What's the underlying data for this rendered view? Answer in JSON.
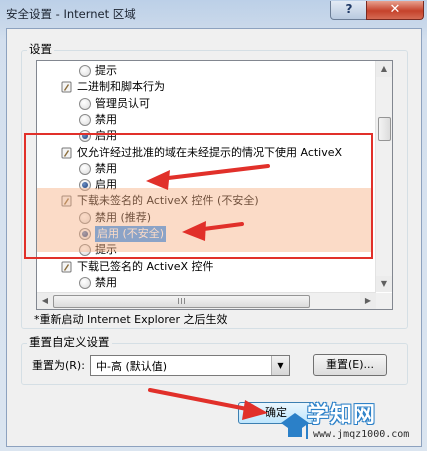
{
  "window": {
    "title": "安全设置 - Internet 区域",
    "help_glyph": "?",
    "close_glyph": "✕"
  },
  "settings_group": {
    "label": "设置",
    "rows": [
      {
        "kind": "radio",
        "text": "提示",
        "checked": false
      },
      {
        "kind": "category",
        "text": "二进制和脚本行为"
      },
      {
        "kind": "radio",
        "text": "管理员认可",
        "checked": false
      },
      {
        "kind": "radio",
        "text": "禁用",
        "checked": false
      },
      {
        "kind": "radio",
        "text": "启用",
        "checked": true
      },
      {
        "kind": "category",
        "text": "仅允许经过批准的域在未经提示的情况下使用 ActiveX"
      },
      {
        "kind": "radio",
        "text": "禁用",
        "checked": false
      },
      {
        "kind": "radio",
        "text": "启用",
        "checked": true
      },
      {
        "kind": "category",
        "text": "下载未签名的 ActiveX 控件 (不安全)"
      },
      {
        "kind": "radio",
        "text": "禁用 (推荐)",
        "checked": false
      },
      {
        "kind": "radio",
        "text": "启用 (不安全)",
        "checked": true,
        "selected": true
      },
      {
        "kind": "radio",
        "text": "提示",
        "checked": false
      },
      {
        "kind": "category",
        "text": "下载已签名的 ActiveX 控件"
      },
      {
        "kind": "radio",
        "text": "禁用",
        "checked": false
      }
    ],
    "note": "*重新启动 Internet Explorer 之后生效"
  },
  "reset_group": {
    "label": "重置自定义设置",
    "reset_to_label": "重置为(R):",
    "combo_value": "中-高 (默认值)",
    "reset_button": "重置(E)..."
  },
  "ok_button": "确定",
  "watermark": {
    "name": "学知网",
    "url": "www.jmqz1000.com"
  },
  "colors": {
    "annotation_red": "#e1302a",
    "highlight_band": "#f7af82",
    "selection": "#3399ff"
  }
}
